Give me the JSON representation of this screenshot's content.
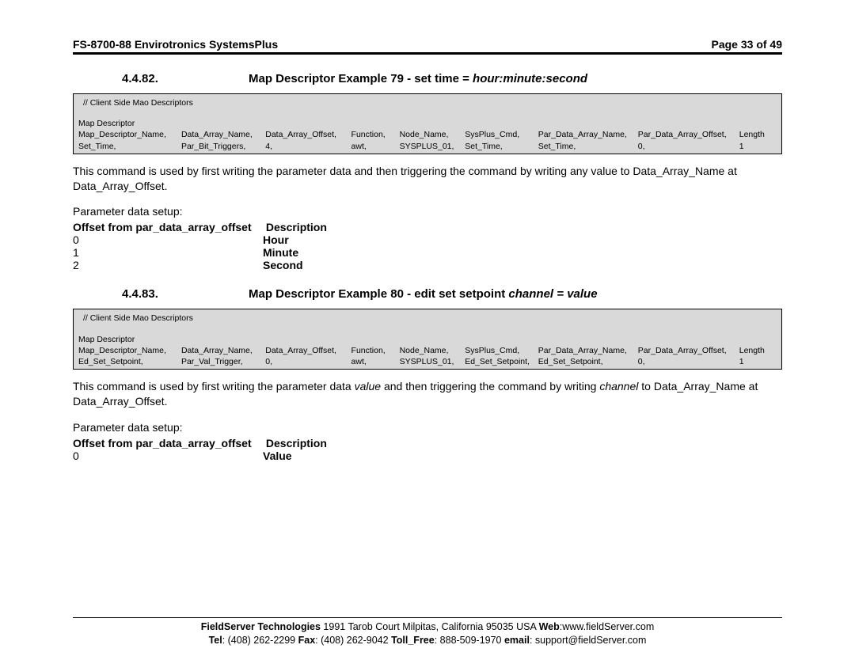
{
  "header": {
    "left": "FS-8700-88 Envirotronics SystemsPlus",
    "right": "Page 33 of 49"
  },
  "s82": {
    "num": "4.4.82.",
    "title_a": "Map Descriptor Example 79 - set time = ",
    "title_b": "hour:minute:second",
    "code": {
      "comment": "//    Client Side Mao Descriptors",
      "sub": "Map Descriptor",
      "h": [
        "Map_Descriptor_Name,",
        "Data_Array_Name,",
        "Data_Array_Offset,",
        "Function,",
        "Node_Name,",
        "SysPlus_Cmd,",
        "Par_Data_Array_Name,",
        "Par_Data_Array_Offset,",
        "Length"
      ],
      "r": [
        "Set_Time,",
        "Par_Bit_Triggers,",
        "4,",
        "awt,",
        "SYSPLUS_01,",
        "Set_Time,",
        "Set_Time,",
        "0,",
        "1"
      ]
    },
    "text": "This command is used by first writing the parameter data and then triggering the command by writing any value to Data_Array_Name at Data_Array_Offset.",
    "param_label": "Parameter data setup:",
    "param_hdr_a": "Offset from par_data_array_offset",
    "param_hdr_b": "Description",
    "rows": [
      {
        "a": "0",
        "b": "Hour"
      },
      {
        "a": "1",
        "b": "Minute"
      },
      {
        "a": "2",
        "b": "Second"
      }
    ]
  },
  "s83": {
    "num": "4.4.83.",
    "title_a": "Map Descriptor Example 80 - edit set setpoint ",
    "title_b": "channel = value",
    "code": {
      "comment": "//    Client Side Mao Descriptors",
      "sub": "Map Descriptor",
      "h": [
        "Map_Descriptor_Name,",
        "Data_Array_Name,",
        "Data_Array_Offset,",
        "Function,",
        "Node_Name,",
        "SysPlus_Cmd,",
        "Par_Data_Array_Name,",
        "Par_Data_Array_Offset,",
        "Length"
      ],
      "r": [
        "Ed_Set_Setpoint,",
        "Par_Val_Trigger,",
        "0,",
        "awt,",
        "SYSPLUS_01,",
        "Ed_Set_Setpoint,",
        "Ed_Set_Setpoint,",
        "0,",
        "1"
      ]
    },
    "text_a": "This command is used by first writing the parameter data ",
    "text_b": "value",
    "text_c": " and then triggering the command by writing ",
    "text_d": "channel ",
    "text_e": " to Data_Array_Name at Data_Array_Offset.",
    "param_label": "Parameter data setup:",
    "param_hdr_a": "Offset from par_data_array_offset",
    "param_hdr_b": "Description",
    "rows": [
      {
        "a": "0",
        "b": "Value"
      }
    ]
  },
  "footer": {
    "line1_a": "FieldServer Technologies",
    "line1_b": " 1991 Tarob Court Milpitas, California 95035 USA  ",
    "line1_c": "Web",
    "line1_d": ":www.fieldServer.com",
    "line2_a": "Tel",
    "line2_b": ": (408) 262-2299  ",
    "line2_c": "Fax",
    "line2_d": ": (408) 262-9042   ",
    "line2_e": "Toll_Free",
    "line2_f": ": 888-509-1970   ",
    "line2_g": "email",
    "line2_h": ": support@fieldServer.com"
  }
}
